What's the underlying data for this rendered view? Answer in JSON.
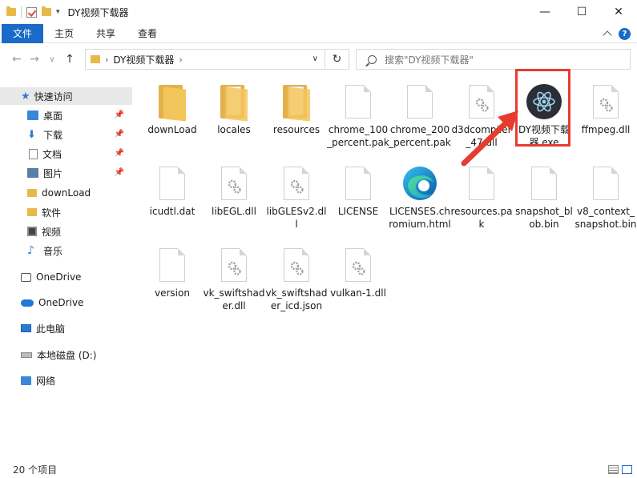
{
  "window": {
    "title": "DY视频下载器",
    "minimize": "—",
    "maximize": "☐",
    "close": "✕"
  },
  "ribbon": {
    "tabs": [
      "文件",
      "主页",
      "共享",
      "查看"
    ],
    "help": "?"
  },
  "nav": {
    "back": "←",
    "forward": "→",
    "recent": "∨",
    "up": "↑",
    "path": "DY视频下载器",
    "path_separator": "›",
    "refresh": "↻",
    "search_placeholder": "搜索\"DY视频下载器\""
  },
  "sidebar": {
    "quick_access": "快速访问",
    "items": [
      {
        "label": "桌面",
        "icon": "desktop-icon",
        "pinned": true
      },
      {
        "label": "下载",
        "icon": "download-icon",
        "pinned": true
      },
      {
        "label": "文档",
        "icon": "document-icon",
        "pinned": true
      },
      {
        "label": "图片",
        "icon": "pictures-icon",
        "pinned": true
      },
      {
        "label": "downLoad",
        "icon": "folder-icon",
        "pinned": false
      },
      {
        "label": "软件",
        "icon": "folder-icon",
        "pinned": false
      },
      {
        "label": "视频",
        "icon": "video-icon",
        "pinned": false
      },
      {
        "label": "音乐",
        "icon": "music-icon",
        "pinned": false
      }
    ],
    "onedrive_1": "OneDrive",
    "onedrive_2": "OneDrive",
    "this_pc": "此电脑",
    "local_disk": "本地磁盘 (D:)",
    "network": "网络"
  },
  "files": [
    {
      "name": "downLoad",
      "type": "folder-icon"
    },
    {
      "name": "locales",
      "type": "folder-icon"
    },
    {
      "name": "resources",
      "type": "folder-icon"
    },
    {
      "name": "chrome_100_percent.pak",
      "type": "file-icon"
    },
    {
      "name": "chrome_200_percent.pak",
      "type": "file-icon"
    },
    {
      "name": "d3dcompiler_47.dll",
      "type": "dll-gear-icon"
    },
    {
      "name": "DY视频下载器.exe",
      "type": "app-icon"
    },
    {
      "name": "ffmpeg.dll",
      "type": "dll-gear-icon"
    },
    {
      "name": "icudtl.dat",
      "type": "file-icon"
    },
    {
      "name": "libEGL.dll",
      "type": "dll-gear-icon"
    },
    {
      "name": "libGLESv2.dll",
      "type": "dll-gear-icon"
    },
    {
      "name": "LICENSE",
      "type": "file-icon"
    },
    {
      "name": "LICENSES.chromium.html",
      "type": "edge-icon"
    },
    {
      "name": "resources.pak",
      "type": "file-icon"
    },
    {
      "name": "snapshot_blob.bin",
      "type": "file-icon"
    },
    {
      "name": "v8_context_snapshot.bin",
      "type": "file-icon"
    },
    {
      "name": "version",
      "type": "file-icon"
    },
    {
      "name": "vk_swiftshader.dll",
      "type": "dll-gear-icon"
    },
    {
      "name": "vk_swiftshader_icd.json",
      "type": "dll-gear-icon"
    },
    {
      "name": "vulkan-1.dll",
      "type": "dll-gear-icon"
    }
  ],
  "status": {
    "count": "20 个项目"
  },
  "colors": {
    "accent": "#1a6bc8",
    "highlight": "#e63c2f",
    "folder": "#f3c65c"
  }
}
